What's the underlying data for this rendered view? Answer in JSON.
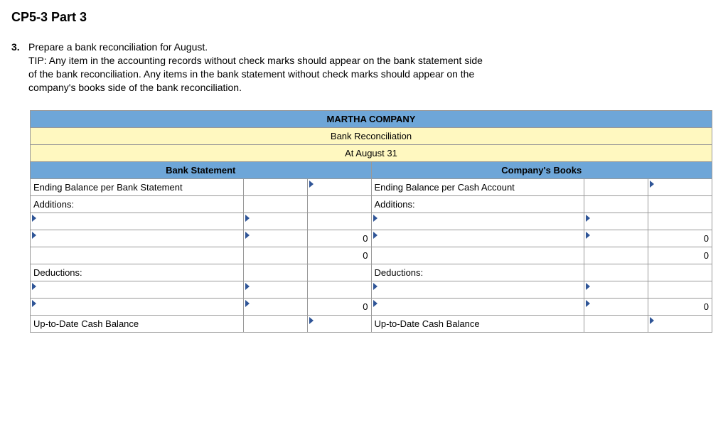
{
  "title": "CP5-3 Part 3",
  "question_number": "3.",
  "question_text": "Prepare a bank reconciliation for August.",
  "tip_lines": [
    "TIP: Any item in the accounting records without check marks should appear on the bank statement side",
    "of the bank reconciliation. Any items in the bank statement without check marks should appear on the",
    "company's books side of the bank reconciliation."
  ],
  "header": {
    "company": "MARTHA COMPANY",
    "subtitle": "Bank Reconciliation",
    "date": "At August 31"
  },
  "columns": {
    "bank_side": "Bank Statement",
    "book_side": "Company's Books"
  },
  "rows": {
    "bank_ending": "Ending Balance per Bank Statement",
    "book_ending": "Ending Balance per Cash Account",
    "additions": "Additions:",
    "deductions": "Deductions:",
    "uptodate": "Up-to-Date Cash Balance",
    "zero": "0"
  }
}
